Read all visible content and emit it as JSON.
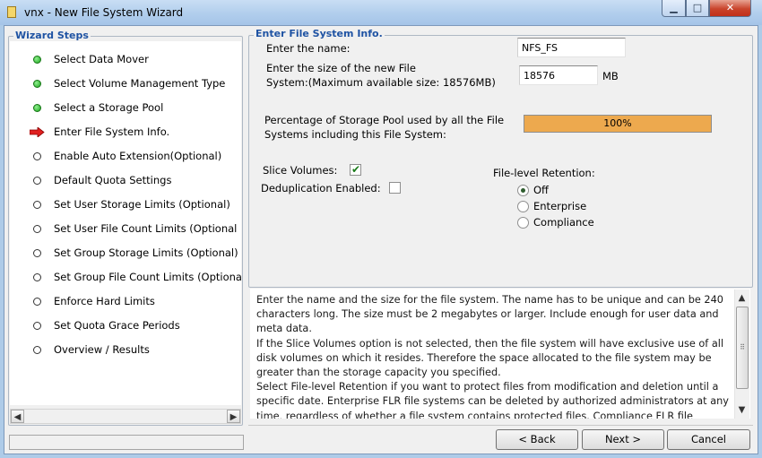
{
  "window": {
    "title": "vnx - New File System Wizard",
    "min_glyph": "▁",
    "max_glyph": "□",
    "close_glyph": "✕"
  },
  "steps": {
    "legend": "Wizard Steps",
    "items": [
      {
        "label": "Select Data Mover",
        "state": "done"
      },
      {
        "label": "Select Volume Management Type",
        "state": "done"
      },
      {
        "label": "Select a Storage Pool",
        "state": "done"
      },
      {
        "label": "Enter File System Info.",
        "state": "current"
      },
      {
        "label": "Enable Auto Extension(Optional)",
        "state": "todo"
      },
      {
        "label": "Default Quota Settings",
        "state": "todo"
      },
      {
        "label": "Set User Storage Limits (Optional)",
        "state": "todo"
      },
      {
        "label": "Set User File Count Limits  (Optional",
        "state": "todo"
      },
      {
        "label": "Set Group Storage Limits (Optional)",
        "state": "todo"
      },
      {
        "label": "Set Group File Count Limits (Optiona",
        "state": "todo"
      },
      {
        "label": "Enforce Hard Limits",
        "state": "todo"
      },
      {
        "label": "Set Quota Grace Periods",
        "state": "todo"
      },
      {
        "label": "Overview / Results",
        "state": "todo"
      }
    ],
    "scroll_left": "◀",
    "scroll_right": "▶"
  },
  "info": {
    "legend": "Enter File System Info.",
    "name_label": "Enter the name:",
    "name_value": "NFS_FS",
    "size_label_line1": "Enter the size of the new File",
    "size_label_line2": "System:(Maximum available size: 18576MB)",
    "size_value": "18576",
    "size_unit": "MB",
    "pool_label_line1": "Percentage of Storage Pool used by all the File",
    "pool_label_line2": "Systems including this File System:",
    "pool_percent": 100,
    "pool_text": "100%",
    "pool_color": "#eda94e",
    "slice_label": "Slice Volumes:",
    "slice_checked": true,
    "dedup_label": "Deduplication Enabled:",
    "dedup_checked": false,
    "check_glyph": "✔",
    "retention_label": "File-level Retention:",
    "retention_options": [
      "Off",
      "Enterprise",
      "Compliance"
    ],
    "retention_selected": "Off"
  },
  "help": {
    "paragraphs": [
      "Enter the name and the size for the file system. The name has to be unique and can be 240 characters long. The size must be 2 megabytes or larger. Include enough for user data and meta data.",
      "If the Slice Volumes option is not selected, then the file system will have exclusive use of all disk volumes on which it resides. Therefore the space allocated to the file system may be greater than the storage capacity you specified.",
      "Select File-level Retention if you want to protect files from modification and deletion until a specific date. Enterprise FLR file systems can be deleted by authorized administrators at any time, regardless of whether a file system contains protected files. Compliance FLR file systems"
    ],
    "scroll_up": "▲",
    "scroll_down": "▼",
    "thumb_grip": "⠿"
  },
  "buttons": {
    "back": "< Back",
    "next": "Next >",
    "cancel": "Cancel"
  }
}
